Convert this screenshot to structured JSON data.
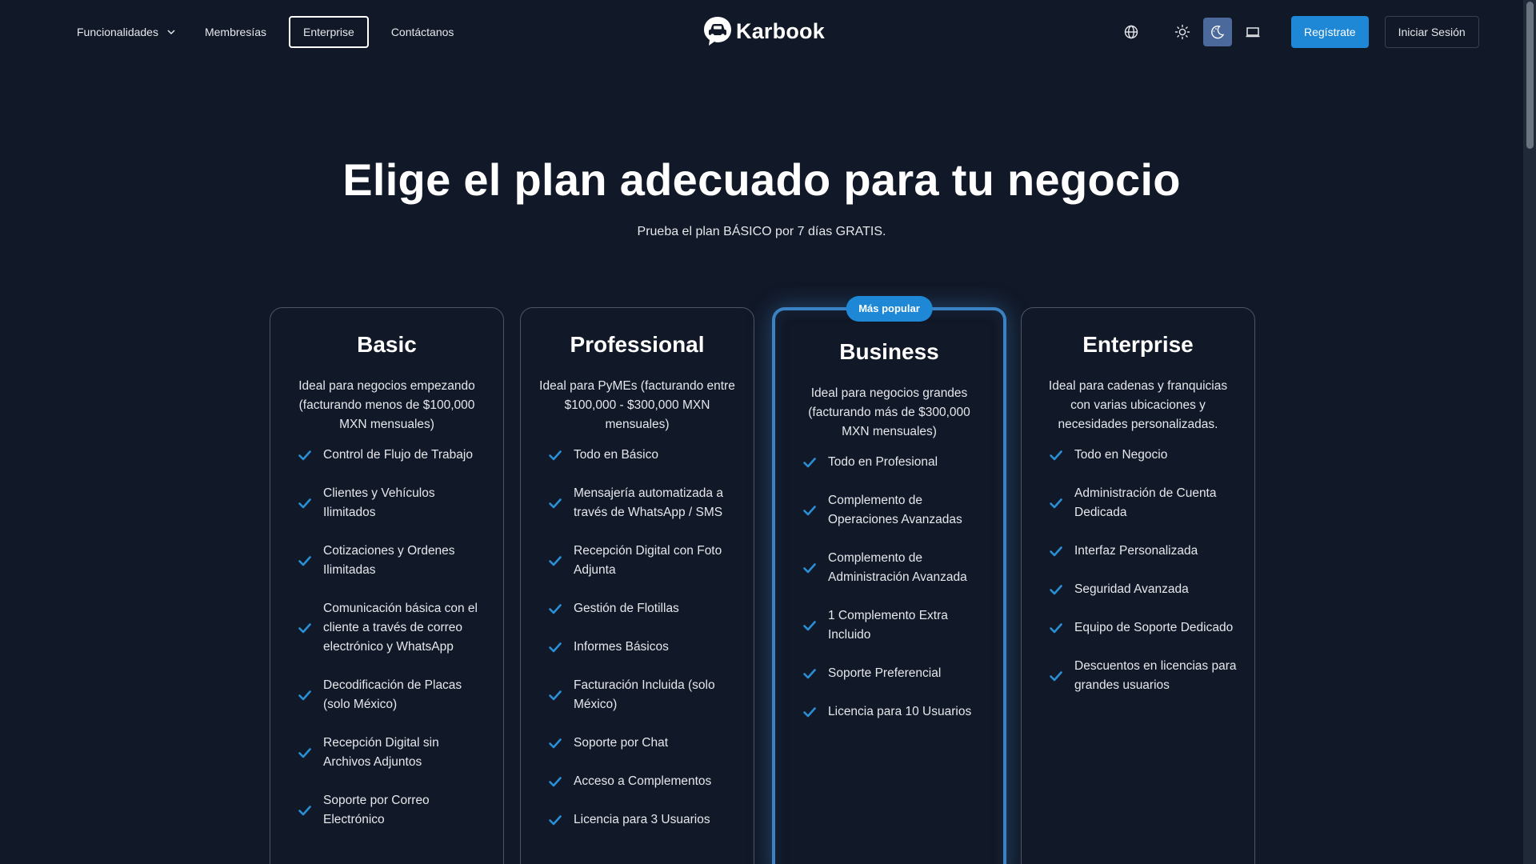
{
  "header": {
    "nav": [
      {
        "label": "Funcionalidades",
        "dropdown": true
      },
      {
        "label": "Membresías"
      },
      {
        "label": "Enterprise",
        "active": true
      },
      {
        "label": "Contáctanos"
      }
    ],
    "logo_text": "Karbook",
    "icons": [
      "globe-icon",
      "sun-icon",
      "moon-icon",
      "monitor-icon"
    ],
    "selected_theme": "moon-icon",
    "register_label": "Regístrate",
    "login_label": "Iniciar Sesión"
  },
  "hero": {
    "title": "Elige el plan adecuado para tu negocio",
    "subtitle": "Prueba el plan BÁSICO por 7 días GRATIS."
  },
  "colors": {
    "background": "#111827",
    "accent": "#1e88d6",
    "check": "#2b8fd6",
    "popular_border": "#3b82c4"
  },
  "plans": [
    {
      "name": "Basic",
      "description": "Ideal para negocios empezando (facturando menos de $100,000 MXN mensuales)",
      "features": [
        "Control de Flujo de Trabajo",
        "Clientes y Vehículos Ilimitados",
        "Cotizaciones y Ordenes Ilimitadas",
        "Comunicación básica con el cliente a través de correo electrónico y WhatsApp",
        "Decodificación de Placas (solo México)",
        "Recepción Digital sin Archivos Adjuntos",
        "Soporte por Correo Electrónico"
      ]
    },
    {
      "name": "Professional",
      "description": "Ideal para PyMEs (facturando entre $100,000 - $300,000 MXN mensuales)",
      "features": [
        "Todo en Básico",
        "Mensajería automatizada a través de WhatsApp / SMS",
        "Recepción Digital con Foto Adjunta",
        "Gestión de Flotillas",
        "Informes Básicos",
        "Facturación Incluida (solo México)",
        "Soporte por Chat",
        "Acceso a Complementos",
        "Licencia para 3 Usuarios"
      ]
    },
    {
      "name": "Business",
      "badge": "Más popular",
      "description": "Ideal para negocios grandes (facturando más de $300,000 MXN mensuales)",
      "features": [
        "Todo en Profesional",
        "Complemento de Operaciones Avanzadas",
        "Complemento de Administración Avanzada",
        "1 Complemento Extra Incluido",
        "Soporte Preferencial",
        "Licencia para 10 Usuarios"
      ]
    },
    {
      "name": "Enterprise",
      "description": "Ideal para cadenas y franquicias con varias ubicaciones y necesidades personalizadas.",
      "features": [
        "Todo en Negocio",
        "Administración de Cuenta Dedicada",
        "Interfaz Personalizada",
        "Seguridad Avanzada",
        "Equipo de Soporte Dedicado",
        "Descuentos en licencias para grandes usuarios"
      ]
    }
  ]
}
